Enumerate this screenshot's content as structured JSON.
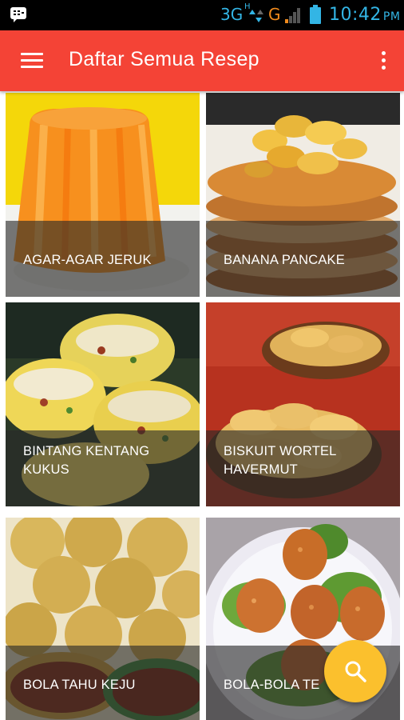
{
  "status_bar": {
    "network_3g": "3G",
    "network_hplus": "H",
    "network_g": "G",
    "time": "10:42",
    "ampm": "PM"
  },
  "app_bar": {
    "title": "Daftar Semua Resep",
    "menu_icon": "hamburger-menu-icon",
    "overflow_icon": "more-vert-icon"
  },
  "recipes": [
    {
      "name": "AGAR-AGAR JERUK"
    },
    {
      "name": "BANANA PANCAKE"
    },
    {
      "name": "BINTANG KENTANG KUKUS"
    },
    {
      "name": "BISKUIT WORTEL HAVERMUT"
    },
    {
      "name": "BOLA TAHU KEJU"
    },
    {
      "name": "BOLA-BOLA TE"
    }
  ],
  "fab": {
    "icon": "search-icon",
    "color": "#fbc02d"
  },
  "colors": {
    "app_bar": "#f44336",
    "status_accent": "#33b5e5"
  }
}
